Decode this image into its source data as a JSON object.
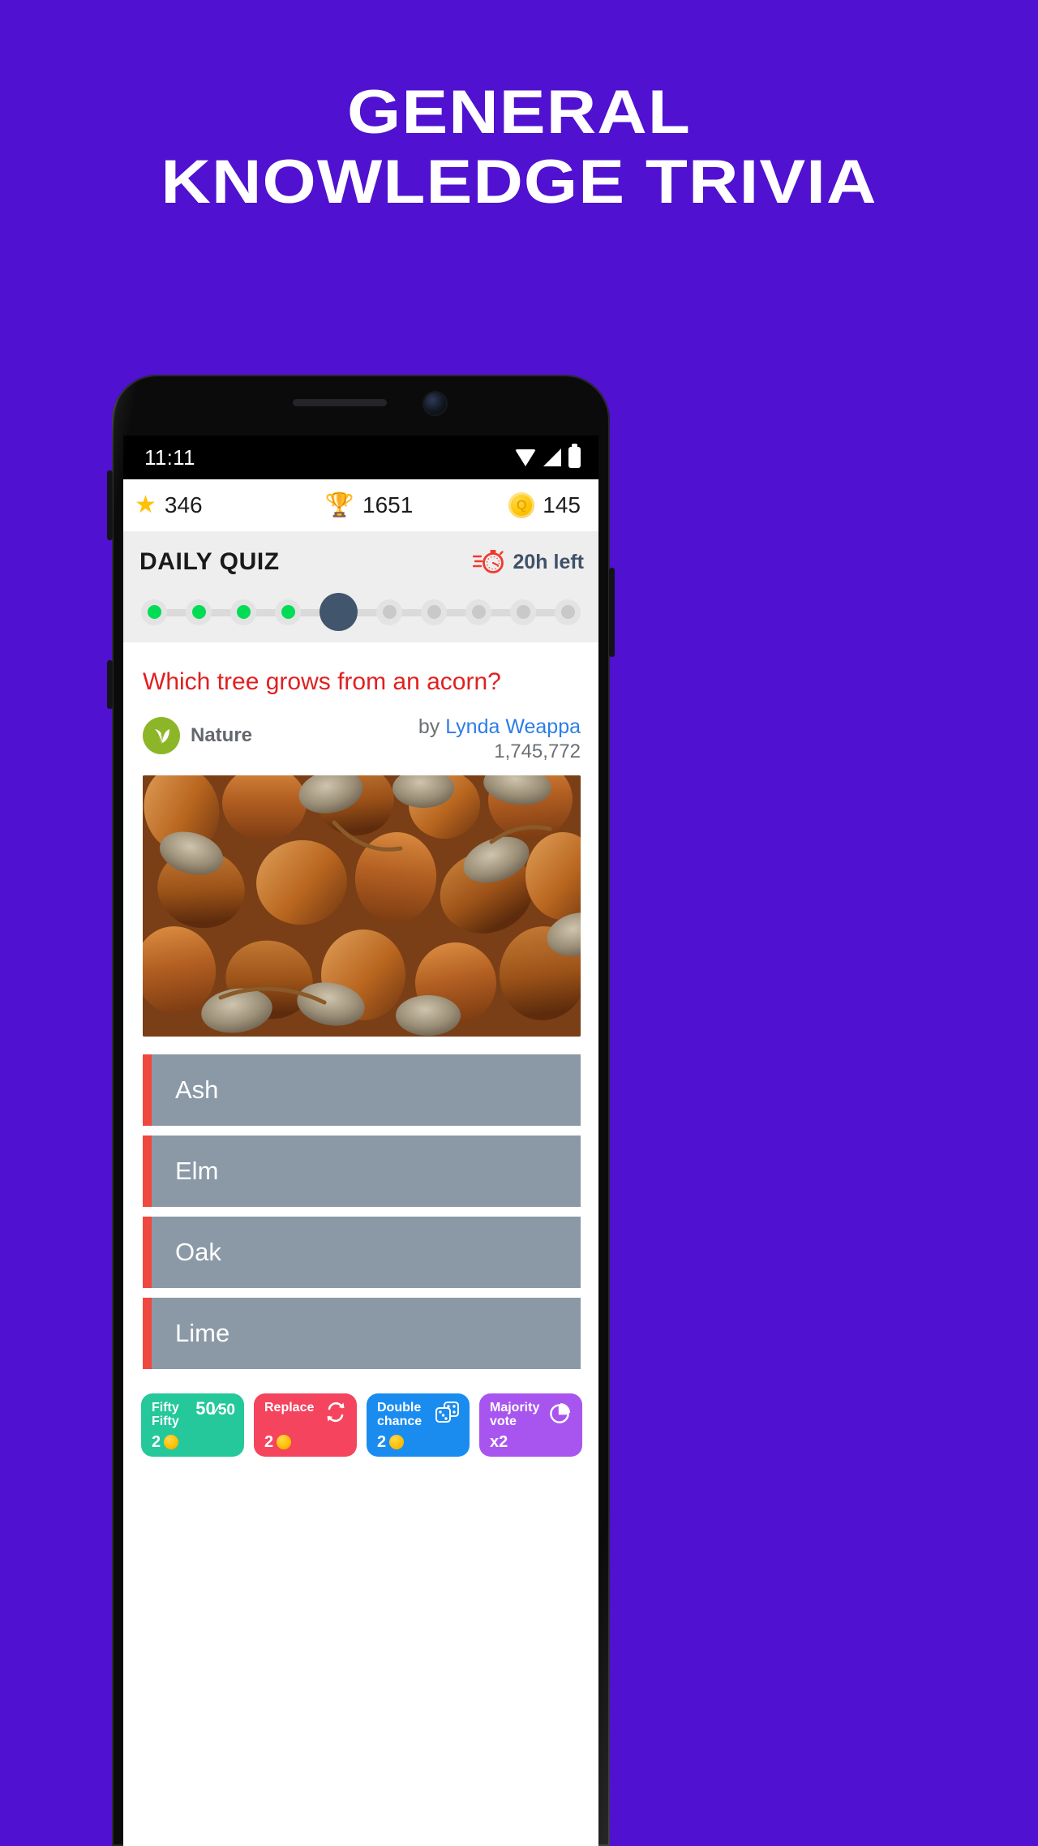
{
  "promo": {
    "headline_line1": "GENERAL",
    "headline_line2": "KNOWLEDGE TRIVIA",
    "background_color": "#5011d0"
  },
  "status_bar": {
    "time": "11:11",
    "icons": [
      "wifi-icon",
      "signal-icon",
      "battery-icon"
    ]
  },
  "stats": {
    "star": {
      "icon": "star-icon",
      "value": "346"
    },
    "trophy": {
      "icon": "trophy-icon",
      "value": "1651"
    },
    "coin": {
      "icon": "coin-icon",
      "coin_letter": "Q",
      "value": "145"
    }
  },
  "quiz_header": {
    "title": "DAILY QUIZ",
    "timer_icon": "stopwatch-icon",
    "timer_label": "20h left"
  },
  "progress": {
    "total": 10,
    "completed": 4,
    "current_index": 5,
    "states": [
      "done",
      "done",
      "done",
      "done",
      "current",
      "pending",
      "pending",
      "pending",
      "pending",
      "pending"
    ],
    "done_color": "#00dd55",
    "current_color": "#41556c",
    "pending_color": "#c9c9c9"
  },
  "question": {
    "text": "Which tree grows from an acorn?",
    "text_color": "#e12020",
    "category": {
      "name": "Nature",
      "icon": "leaf-icon",
      "color": "#8cb627"
    },
    "by_prefix": "by ",
    "author": "Lynda Weappa",
    "play_count": "1,745,772",
    "image_alt": "acorns"
  },
  "answers": [
    {
      "label": "Ash"
    },
    {
      "label": "Elm"
    },
    {
      "label": "Oak"
    },
    {
      "label": "Lime"
    }
  ],
  "answer_style": {
    "background": "#8a99a5",
    "accent": "#f0473e"
  },
  "powerups": [
    {
      "name": "Fifty\nFifty",
      "glyph_type": "fifty-fifty",
      "glyph_top": "50",
      "glyph_bottom": "50",
      "cost": "2",
      "cost_type": "coin",
      "color": "#25c89a",
      "icon": "fifty-fifty-icon"
    },
    {
      "name": "Replace",
      "glyph_type": "refresh",
      "cost": "2",
      "cost_type": "coin",
      "color": "#f5445e",
      "icon": "refresh-icon"
    },
    {
      "name": "Double\nchance",
      "glyph_type": "dice",
      "cost": "2",
      "cost_type": "coin",
      "color": "#1a8cf0",
      "icon": "dice-icon"
    },
    {
      "name": "Majority\nvote",
      "glyph_type": "pie",
      "cost": "x2",
      "cost_type": "multiplier",
      "color": "#a855f0",
      "icon": "pie-chart-icon"
    }
  ]
}
